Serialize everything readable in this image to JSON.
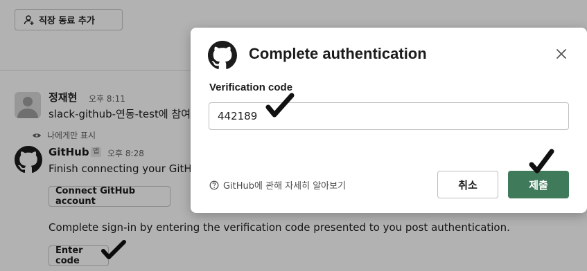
{
  "background": {
    "add_coworker_label": "직장 동료 추가",
    "messages": [
      {
        "name": "정재현",
        "time": "오후 8:11",
        "text": "slack-github-연동-test에 참여"
      },
      {
        "visibility": "나에게만 표시",
        "name": "GitHub",
        "badge": "앱",
        "time": "오후 8:28",
        "text": "Finish connecting your GitHub account",
        "connect_button": "Connect GitHub account",
        "instruction": "Complete sign-in by entering the verification code presented to you post authentication.",
        "enter_code_button": "Enter code"
      }
    ]
  },
  "modal": {
    "title": "Complete authentication",
    "close_icon": "close-icon",
    "field_label": "Verification code",
    "code_value": "442189",
    "help_text": "GitHub에 관해 자세히 알아보기",
    "cancel_label": "취소",
    "submit_label": "제출",
    "submit_color": "#3f7a5a"
  }
}
